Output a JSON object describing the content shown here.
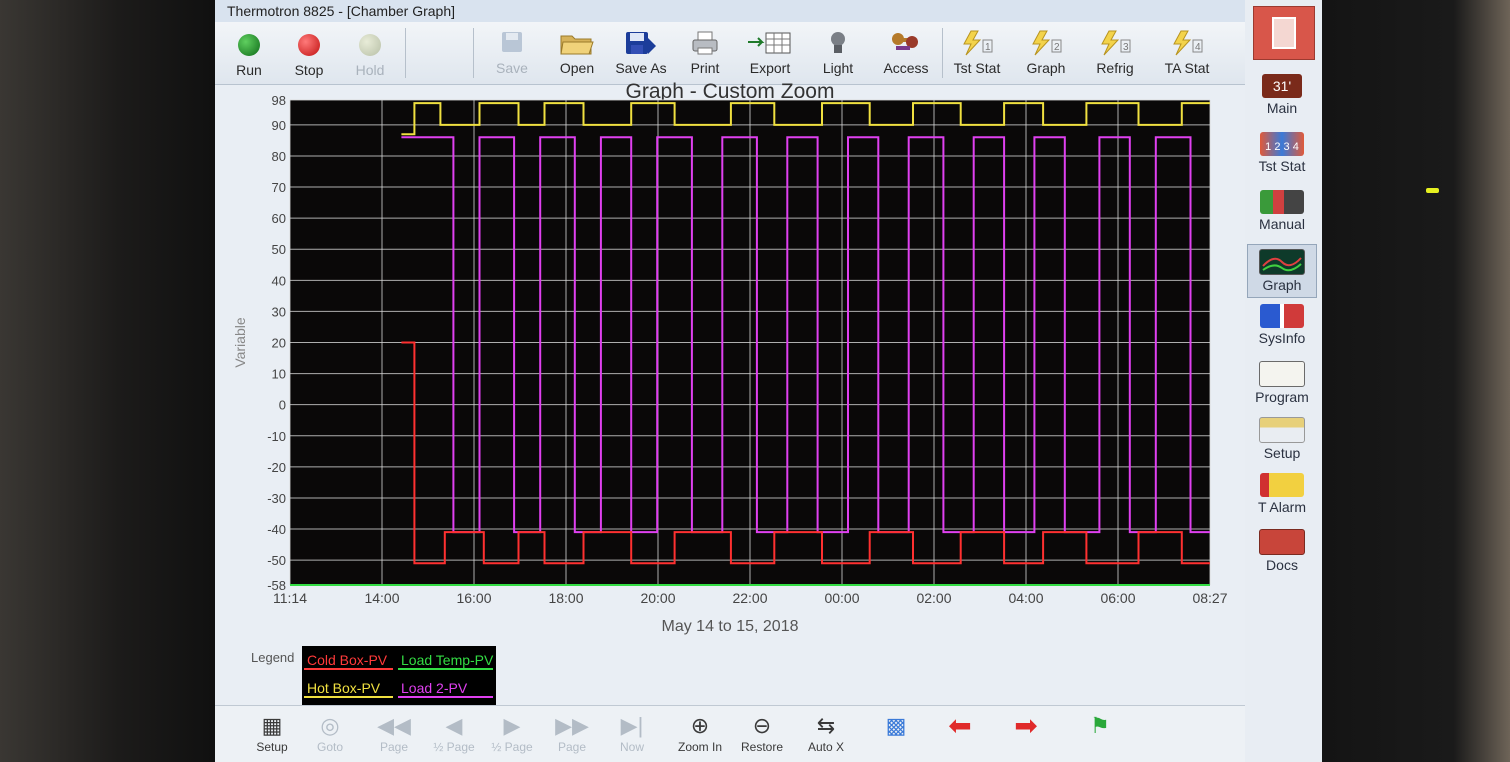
{
  "window": {
    "title": "Thermotron 8825 - [Chamber Graph]"
  },
  "toolbar": {
    "run": "Run",
    "stop": "Stop",
    "hold": "Hold",
    "save": "Save",
    "open": "Open",
    "save_as": "Save As",
    "print": "Print",
    "export": "Export",
    "light": "Light",
    "access": "Access",
    "tst_stat": "Tst Stat",
    "graph": "Graph",
    "refrig": "Refrig",
    "ta_stat": "TA Stat",
    "tst_stat_num": "1",
    "graph_num": "2",
    "refrig_num": "3",
    "ta_stat_num": "4"
  },
  "sidebar": {
    "main_badge": "31'",
    "items": [
      {
        "label": "Main"
      },
      {
        "label": "Tst Stat"
      },
      {
        "label": "Manual"
      },
      {
        "label": "Graph"
      },
      {
        "label": "SysInfo"
      },
      {
        "label": "Program"
      },
      {
        "label": "Setup"
      },
      {
        "label": "T Alarm"
      },
      {
        "label": "Docs"
      }
    ],
    "tst_stat_digits": "1 2 3 4"
  },
  "graph": {
    "title": "Graph - Custom Zoom",
    "date_range": "May 14 to 15, 2018"
  },
  "legend": {
    "label": "Legend",
    "items": [
      "Cold Box-PV",
      "Load Temp-PV",
      "Hot Box-PV",
      "Load 2-PV"
    ]
  },
  "bottombar": {
    "setup": "Setup",
    "goto": "Goto",
    "page_back": "Page",
    "half_back": "½ Page",
    "half_fwd": "½ Page",
    "page_fwd": "Page",
    "now": "Now",
    "zoom_in": "Zoom In",
    "restore": "Restore",
    "auto_x": "Auto X"
  },
  "colors": {
    "cold_box": "#ff3030",
    "load_temp": "#33dd44",
    "hot_box": "#f0e040",
    "load_2": "#e040f0",
    "plot_bg": "#0a0808",
    "grid": "#d8d8d8"
  },
  "icons": {
    "run": "green-circle",
    "stop": "red-circle",
    "hold": "grey-circle",
    "save": "floppy-icon",
    "open": "folder-icon",
    "save_as": "floppy-blue-icon",
    "print": "printer-icon",
    "export": "export-icon",
    "light": "bulb-icon",
    "access": "keys-icon",
    "lightning": "lightning-icon"
  },
  "chart_data": {
    "type": "line",
    "title": "Graph - Custom Zoom",
    "xlabel": "May 14 to 15, 2018",
    "ylabel": "Variable",
    "x_tick_labels": [
      "11:14",
      "14:00",
      "16:00",
      "18:00",
      "20:00",
      "22:00",
      "00:00",
      "02:00",
      "04:00",
      "06:00",
      "08:27"
    ],
    "y_ticks": [
      98,
      90,
      80,
      70,
      60,
      50,
      40,
      30,
      20,
      10,
      0,
      -10,
      -20,
      -30,
      -40,
      -50,
      -58
    ],
    "ylim": [
      -58,
      98
    ],
    "x_range_hours": [
      11.23,
      32.45
    ],
    "grid": true,
    "legend_position": "bottom-left",
    "series": [
      {
        "name": "Hot Box-PV",
        "color": "#f0e040",
        "x": [
          13.8,
          14.1,
          14.7,
          15.6,
          16.5,
          17.1,
          18.0,
          19.1,
          20.1,
          21.4,
          22.4,
          23.5,
          24.6,
          25.6,
          26.7,
          27.7,
          28.6,
          29.6,
          30.8,
          31.8
        ],
        "y": [
          87,
          97,
          90,
          97,
          90,
          97,
          90,
          97,
          90,
          97,
          90,
          97,
          90,
          97,
          90,
          97,
          90,
          97,
          90,
          97
        ]
      },
      {
        "name": "Load 2-PV",
        "color": "#e040f0",
        "x": [
          13.8,
          14.4,
          15.0,
          15.6,
          16.4,
          17.0,
          17.8,
          18.4,
          19.1,
          19.7,
          20.5,
          21.2,
          22.0,
          22.7,
          23.4,
          24.1,
          24.8,
          25.5,
          26.3,
          27.0,
          27.7,
          28.4,
          29.1,
          29.9,
          30.6,
          31.2,
          32.0
        ],
        "y": [
          86,
          86,
          -41,
          86,
          -41,
          86,
          -41,
          86,
          -41,
          86,
          -41,
          86,
          -41,
          86,
          -41,
          86,
          -41,
          86,
          -41,
          86,
          -41,
          86,
          -41,
          86,
          -41,
          86,
          -41
        ]
      },
      {
        "name": "Cold Box-PV",
        "color": "#ff3030",
        "x": [
          13.8,
          14.1,
          14.8,
          15.7,
          16.5,
          17.1,
          18.0,
          19.1,
          20.1,
          21.4,
          22.4,
          23.5,
          24.6,
          25.6,
          26.7,
          27.7,
          28.6,
          29.6,
          30.8,
          31.8
        ],
        "y": [
          20,
          -51,
          -41,
          -51,
          -41,
          -51,
          -41,
          -51,
          -41,
          -51,
          -41,
          -51,
          -41,
          -51,
          -41,
          -51,
          -41,
          -51,
          -41,
          -51
        ]
      },
      {
        "name": "Load Temp-PV",
        "color": "#33dd44",
        "x": [
          11.23,
          32.45
        ],
        "y": [
          -58,
          -58
        ]
      }
    ]
  }
}
